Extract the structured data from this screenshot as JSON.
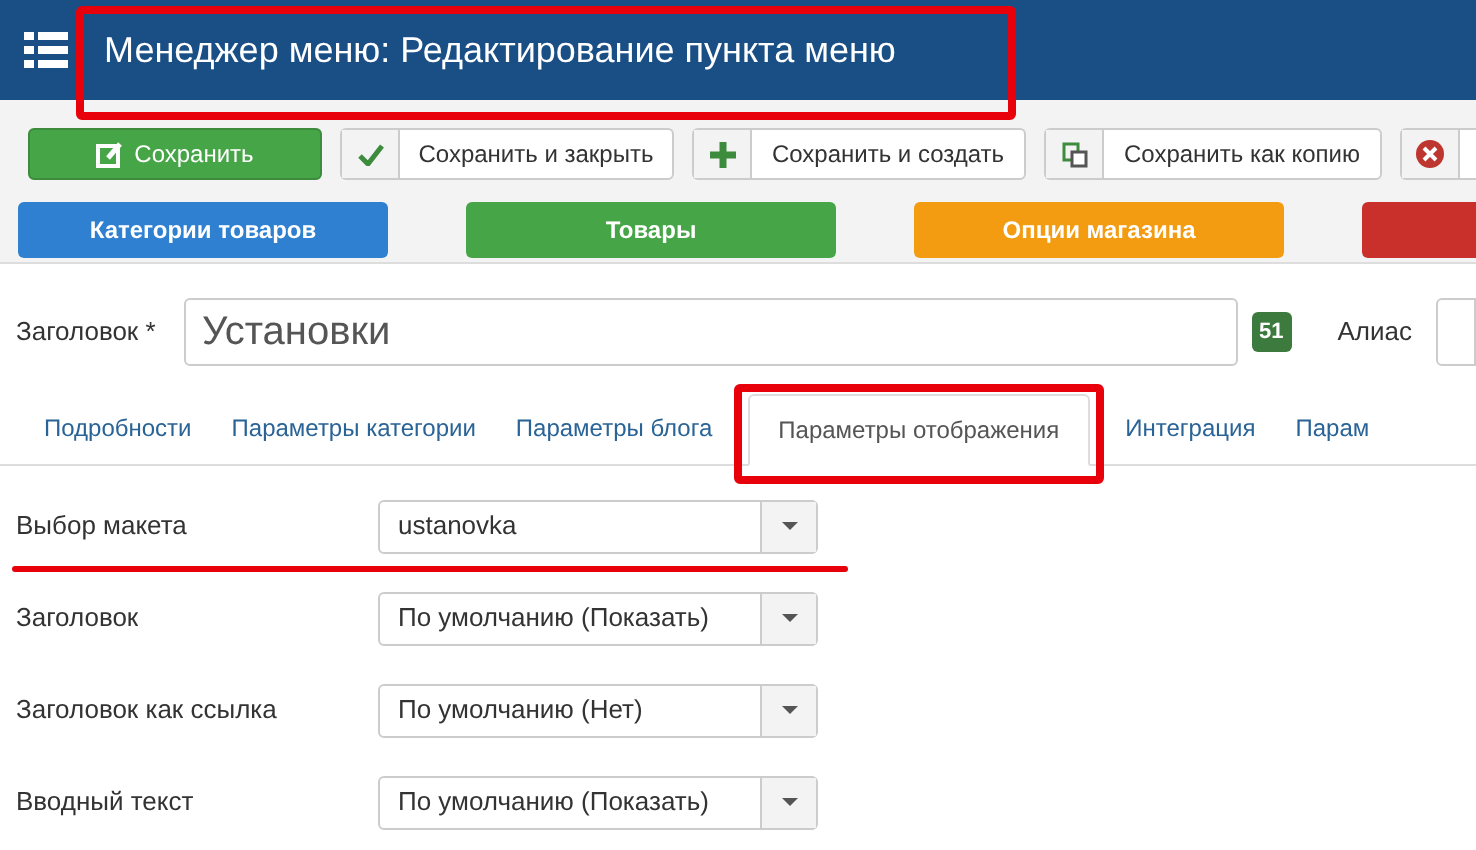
{
  "header": {
    "title": "Менеджер меню: Редактирование пункта меню",
    "highlighted": true
  },
  "toolbar": [
    {
      "kind": "primary",
      "label": "Сохранить"
    },
    {
      "kind": "default",
      "label": "Сохранить и закрыть"
    },
    {
      "kind": "default",
      "label": "Сохранить и создать"
    },
    {
      "kind": "default",
      "label": "Сохранить как копию"
    },
    {
      "kind": "icon_only"
    }
  ],
  "shortcuts": [
    {
      "label": "Категории товаров",
      "color": "#2f80d1"
    },
    {
      "label": "Товары",
      "color": "#46a546"
    },
    {
      "label": "Опции магазина",
      "color": "#f39c12"
    },
    {
      "color": "#c9302c"
    }
  ],
  "title_field": {
    "label": "Заголовок *",
    "value": "Установки",
    "count": "51",
    "alias_label": "Алиас"
  },
  "tabs": [
    {
      "label": "Подробности",
      "selected": false,
      "highlighted": false
    },
    {
      "label": "Параметры категории",
      "selected": false,
      "highlighted": false
    },
    {
      "label": "Параметры блога",
      "selected": false,
      "highlighted": false
    },
    {
      "label": "Параметры отображения",
      "selected": true,
      "highlighted": true
    },
    {
      "label": "Интеграция",
      "selected": false,
      "highlighted": false
    },
    {
      "label": "Парам",
      "selected": false,
      "highlighted": false
    }
  ],
  "fields": [
    {
      "label": "Выбор макета",
      "value": "ustanovka",
      "underlined": true
    },
    {
      "label": "Заголовок",
      "value": "По умолчанию (Показать)",
      "underlined": false
    },
    {
      "label": "Заголовок как ссылка",
      "value": "По умолчанию (Нет)",
      "underlined": false
    },
    {
      "label": "Вводный текст",
      "value": "По умолчанию (Показать)",
      "underlined": false
    }
  ]
}
